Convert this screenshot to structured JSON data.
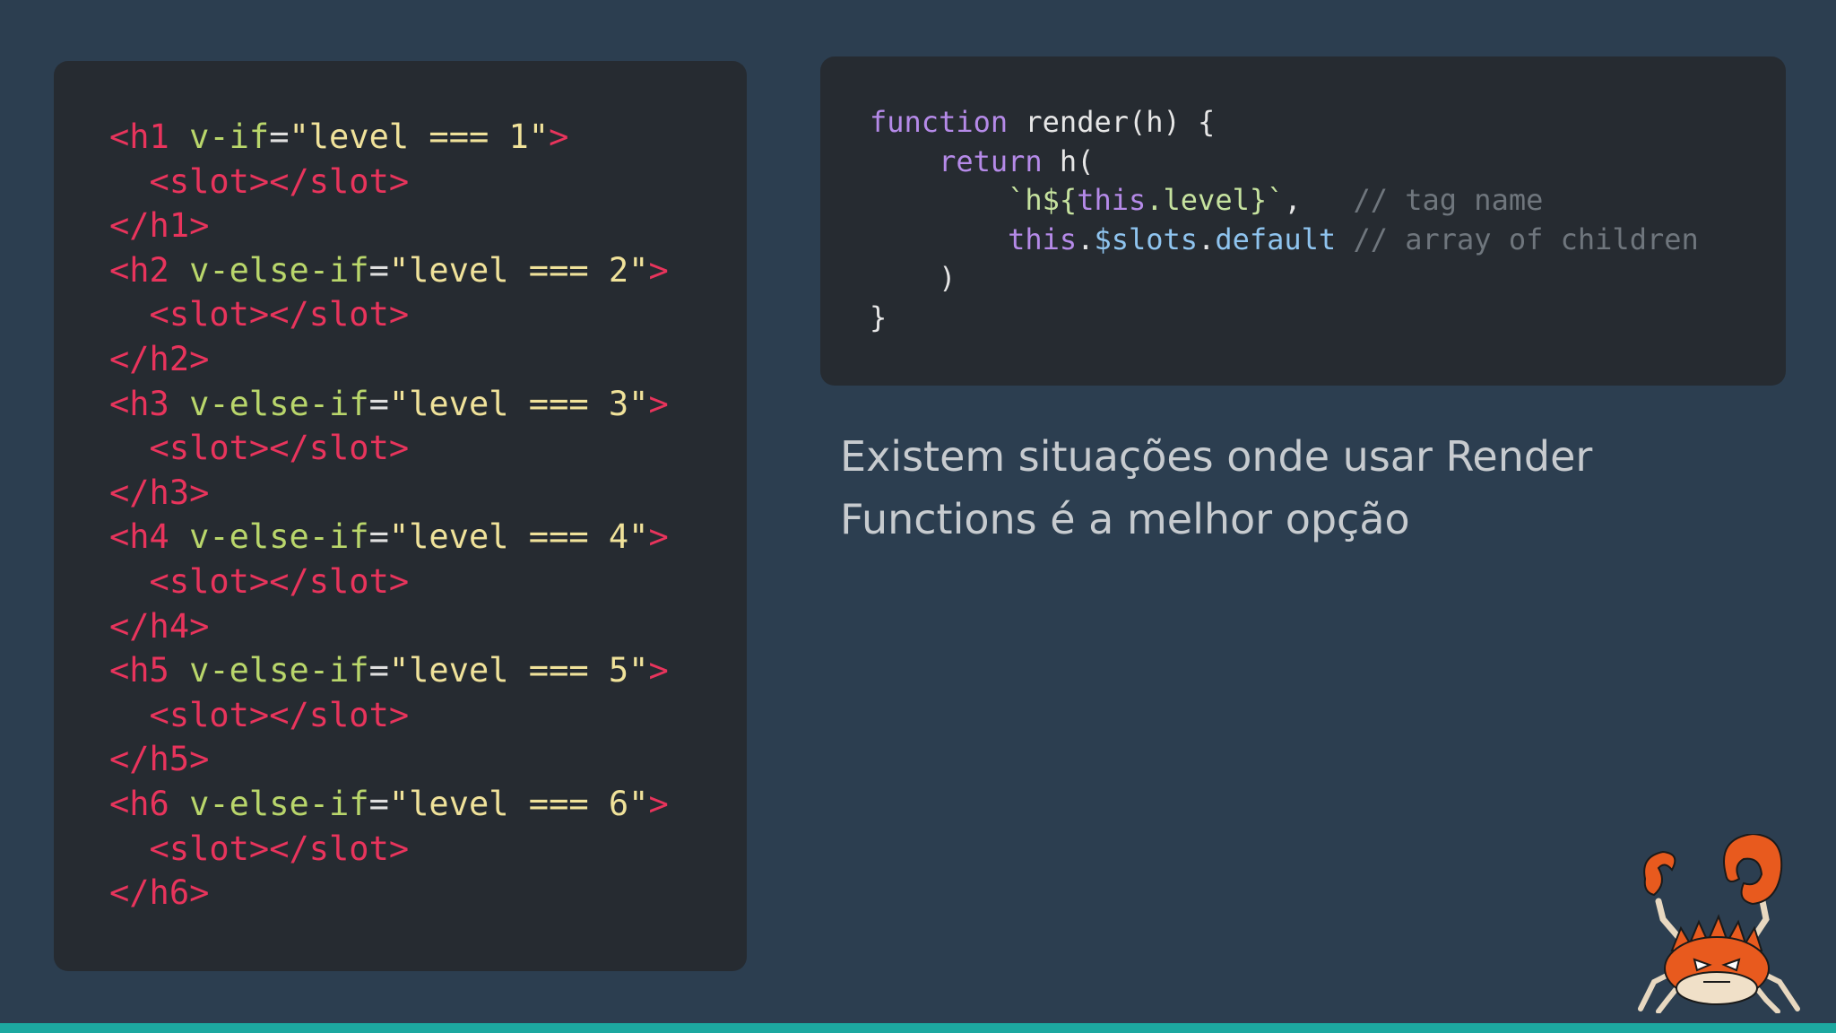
{
  "left_code": {
    "lines": [
      [
        {
          "t": "<h1 ",
          "c": "tag"
        },
        {
          "t": "v-if",
          "c": "attr"
        },
        {
          "t": "=",
          "c": "punc"
        },
        {
          "t": "\"level === 1\"",
          "c": "str"
        },
        {
          "t": ">",
          "c": "tag"
        }
      ],
      [
        {
          "t": "  <slot></slot>",
          "c": "tag"
        }
      ],
      [
        {
          "t": "</h1>",
          "c": "tag"
        }
      ],
      [
        {
          "t": "<h2 ",
          "c": "tag"
        },
        {
          "t": "v-else-if",
          "c": "attr"
        },
        {
          "t": "=",
          "c": "punc"
        },
        {
          "t": "\"level === 2\"",
          "c": "str"
        },
        {
          "t": ">",
          "c": "tag"
        }
      ],
      [
        {
          "t": "  <slot></slot>",
          "c": "tag"
        }
      ],
      [
        {
          "t": "</h2>",
          "c": "tag"
        }
      ],
      [
        {
          "t": "<h3 ",
          "c": "tag"
        },
        {
          "t": "v-else-if",
          "c": "attr"
        },
        {
          "t": "=",
          "c": "punc"
        },
        {
          "t": "\"level === 3\"",
          "c": "str"
        },
        {
          "t": ">",
          "c": "tag"
        }
      ],
      [
        {
          "t": "  <slot></slot>",
          "c": "tag"
        }
      ],
      [
        {
          "t": "</h3>",
          "c": "tag"
        }
      ],
      [
        {
          "t": "<h4 ",
          "c": "tag"
        },
        {
          "t": "v-else-if",
          "c": "attr"
        },
        {
          "t": "=",
          "c": "punc"
        },
        {
          "t": "\"level === 4\"",
          "c": "str"
        },
        {
          "t": ">",
          "c": "tag"
        }
      ],
      [
        {
          "t": "  <slot></slot>",
          "c": "tag"
        }
      ],
      [
        {
          "t": "</h4>",
          "c": "tag"
        }
      ],
      [
        {
          "t": "<h5 ",
          "c": "tag"
        },
        {
          "t": "v-else-if",
          "c": "attr"
        },
        {
          "t": "=",
          "c": "punc"
        },
        {
          "t": "\"level === 5\"",
          "c": "str"
        },
        {
          "t": ">",
          "c": "tag"
        }
      ],
      [
        {
          "t": "  <slot></slot>",
          "c": "tag"
        }
      ],
      [
        {
          "t": "</h5>",
          "c": "tag"
        }
      ],
      [
        {
          "t": "<h6 ",
          "c": "tag"
        },
        {
          "t": "v-else-if",
          "c": "attr"
        },
        {
          "t": "=",
          "c": "punc"
        },
        {
          "t": "\"level === 6\"",
          "c": "str"
        },
        {
          "t": ">",
          "c": "tag"
        }
      ],
      [
        {
          "t": "  <slot></slot>",
          "c": "tag"
        }
      ],
      [
        {
          "t": "</h6>",
          "c": "tag"
        }
      ]
    ]
  },
  "right_code": {
    "lines": [
      [
        {
          "t": "function",
          "c": "kw"
        },
        {
          "t": " render(h) {",
          "c": "plain"
        }
      ],
      [
        {
          "t": "    return",
          "c": "kw"
        },
        {
          "t": " h(",
          "c": "plain"
        }
      ],
      [
        {
          "t": "        `h${",
          "c": "tpl"
        },
        {
          "t": "this",
          "c": "kw"
        },
        {
          "t": ".level",
          "c": "tpl"
        },
        {
          "t": "}`",
          "c": "tpl"
        },
        {
          "t": ",   ",
          "c": "plain"
        },
        {
          "t": "// tag name",
          "c": "cmt"
        }
      ],
      [
        {
          "t": "        ",
          "c": "plain"
        },
        {
          "t": "this",
          "c": "kw"
        },
        {
          "t": ".",
          "c": "plain"
        },
        {
          "t": "$slots",
          "c": "prop"
        },
        {
          "t": ".",
          "c": "plain"
        },
        {
          "t": "default",
          "c": "prop"
        },
        {
          "t": " ",
          "c": "plain"
        },
        {
          "t": "// array of children",
          "c": "cmt"
        }
      ],
      [
        {
          "t": "    )",
          "c": "plain"
        }
      ],
      [
        {
          "t": "}",
          "c": "plain"
        }
      ]
    ]
  },
  "description": {
    "line1": "Existem situações onde usar Render",
    "line2": "Functions é a melhor opção"
  },
  "colors": {
    "background": "#2c3e50",
    "panel": "#262b31",
    "accent_bar": "#1da8a0"
  },
  "icons": {
    "mascot": "crab-mascot-icon"
  }
}
